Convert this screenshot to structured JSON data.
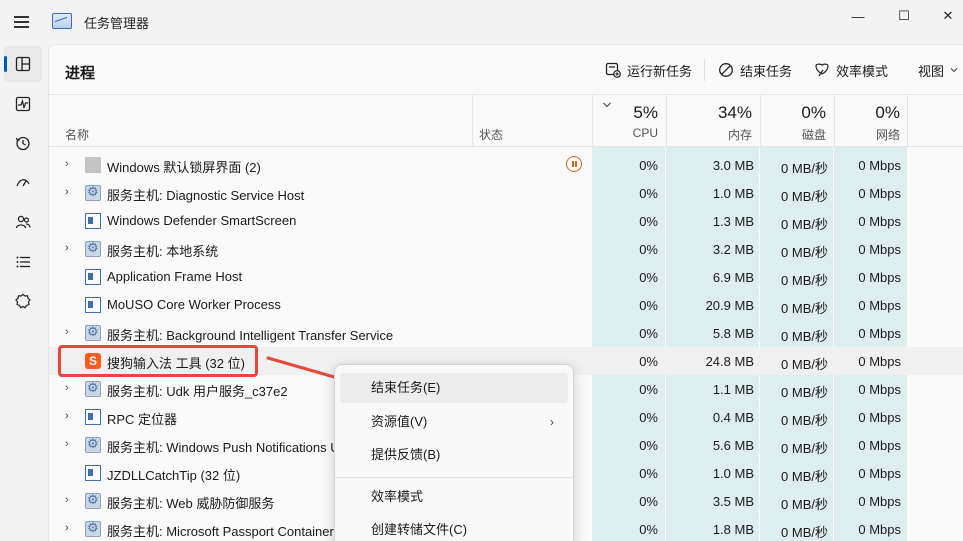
{
  "app": {
    "title": "任务管理器"
  },
  "window_controls": {
    "minimize": "—",
    "maximize": "☐",
    "close": "✕"
  },
  "sidebar": {
    "items": [
      "processes-icon",
      "performance-icon",
      "app-history-icon",
      "startup-icon",
      "users-icon",
      "details-icon",
      "services-icon"
    ]
  },
  "toolbar": {
    "title": "进程",
    "run_new_task": "运行新任务",
    "end_task": "结束任务",
    "efficiency_mode": "效率模式",
    "view": "视图"
  },
  "header": {
    "name": "名称",
    "status": "状态",
    "metrics": [
      {
        "pct": "5%",
        "label": "CPU"
      },
      {
        "pct": "34%",
        "label": "内存"
      },
      {
        "pct": "0%",
        "label": "磁盘"
      },
      {
        "pct": "0%",
        "label": "网络"
      }
    ]
  },
  "rows": [
    {
      "name": "Windows 默认锁屏界面 (2)",
      "cpu": "0%",
      "mem": "3.0 MB",
      "disk": "0 MB/秒",
      "net": "0 Mbps"
    },
    {
      "name": "服务主机: Diagnostic Service Host",
      "cpu": "0%",
      "mem": "1.0 MB",
      "disk": "0 MB/秒",
      "net": "0 Mbps"
    },
    {
      "name": "Windows Defender SmartScreen",
      "cpu": "0%",
      "mem": "1.3 MB",
      "disk": "0 MB/秒",
      "net": "0 Mbps"
    },
    {
      "name": "服务主机: 本地系统",
      "cpu": "0%",
      "mem": "3.2 MB",
      "disk": "0 MB/秒",
      "net": "0 Mbps"
    },
    {
      "name": "Application Frame Host",
      "cpu": "0%",
      "mem": "6.9 MB",
      "disk": "0 MB/秒",
      "net": "0 Mbps"
    },
    {
      "name": "MoUSO Core Worker Process",
      "cpu": "0%",
      "mem": "20.9 MB",
      "disk": "0 MB/秒",
      "net": "0 Mbps"
    },
    {
      "name": "服务主机: Background Intelligent Transfer Service",
      "cpu": "0%",
      "mem": "5.8 MB",
      "disk": "0 MB/秒",
      "net": "0 Mbps"
    },
    {
      "name": "搜狗输入法 工具 (32 位)",
      "cpu": "0%",
      "mem": "24.8 MB",
      "disk": "0 MB/秒",
      "net": "0 Mbps"
    },
    {
      "name": "服务主机: Udk 用户服务_c37e2",
      "cpu": "0%",
      "mem": "1.1 MB",
      "disk": "0 MB/秒",
      "net": "0 Mbps"
    },
    {
      "name": "RPC 定位器",
      "cpu": "0%",
      "mem": "0.4 MB",
      "disk": "0 MB/秒",
      "net": "0 Mbps"
    },
    {
      "name": "服务主机: Windows Push Notifications U",
      "cpu": "0%",
      "mem": "5.6 MB",
      "disk": "0 MB/秒",
      "net": "0 Mbps"
    },
    {
      "name": "JZDLLCatchTip (32 位)",
      "cpu": "0%",
      "mem": "1.0 MB",
      "disk": "0 MB/秒",
      "net": "0 Mbps"
    },
    {
      "name": "服务主机: Web 威胁防御服务",
      "cpu": "0%",
      "mem": "3.5 MB",
      "disk": "0 MB/秒",
      "net": "0 Mbps"
    },
    {
      "name": "服务主机: Microsoft Passport Container",
      "cpu": "0%",
      "mem": "1.8 MB",
      "disk": "0 MB/秒",
      "net": "0 Mbps"
    }
  ],
  "context_menu": {
    "end_task": "结束任务(E)",
    "resource_values": "资源值(V)",
    "feedback": "提供反馈(B)",
    "efficiency_mode": "效率模式",
    "create_dump": "创建转储文件(C)"
  },
  "colors": {
    "accent": "#005fb8",
    "annotation": "#e8473a",
    "data_column": "#deedf0"
  }
}
